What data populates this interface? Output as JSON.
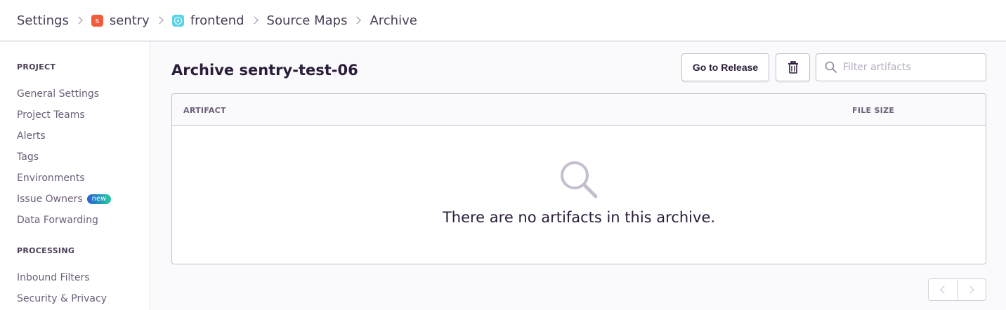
{
  "breadcrumb": {
    "settings": "Settings",
    "org": "sentry",
    "org_badge": "s",
    "project": "frontend",
    "source_maps": "Source Maps",
    "archive": "Archive"
  },
  "sidebar": {
    "project_heading": "PROJECT",
    "project_items": [
      {
        "label": "General Settings"
      },
      {
        "label": "Project Teams"
      },
      {
        "label": "Alerts"
      },
      {
        "label": "Tags"
      },
      {
        "label": "Environments"
      },
      {
        "label": "Issue Owners",
        "badge": "new"
      },
      {
        "label": "Data Forwarding"
      }
    ],
    "processing_heading": "PROCESSING",
    "processing_items": [
      {
        "label": "Inbound Filters"
      },
      {
        "label": "Security & Privacy"
      }
    ]
  },
  "main": {
    "title": "Archive sentry-test-06",
    "go_to_release": "Go to Release",
    "search_placeholder": "Filter artifacts",
    "table": {
      "col_artifact": "ARTIFACT",
      "col_file_size": "FILE SIZE"
    },
    "empty_message": "There are no artifacts in this archive."
  },
  "colors": {
    "org_badge": "#f05c3a",
    "project_badge": "#5ad3ea",
    "text_primary": "#2b1d38",
    "border": "#c6becf"
  },
  "icons": {
    "breadcrumb_separator": "chevron-right-icon",
    "delete": "trash-icon",
    "search": "search-icon",
    "empty": "magnifier-icon",
    "pager_prev": "chevron-left-icon",
    "pager_next": "chevron-right-icon"
  }
}
